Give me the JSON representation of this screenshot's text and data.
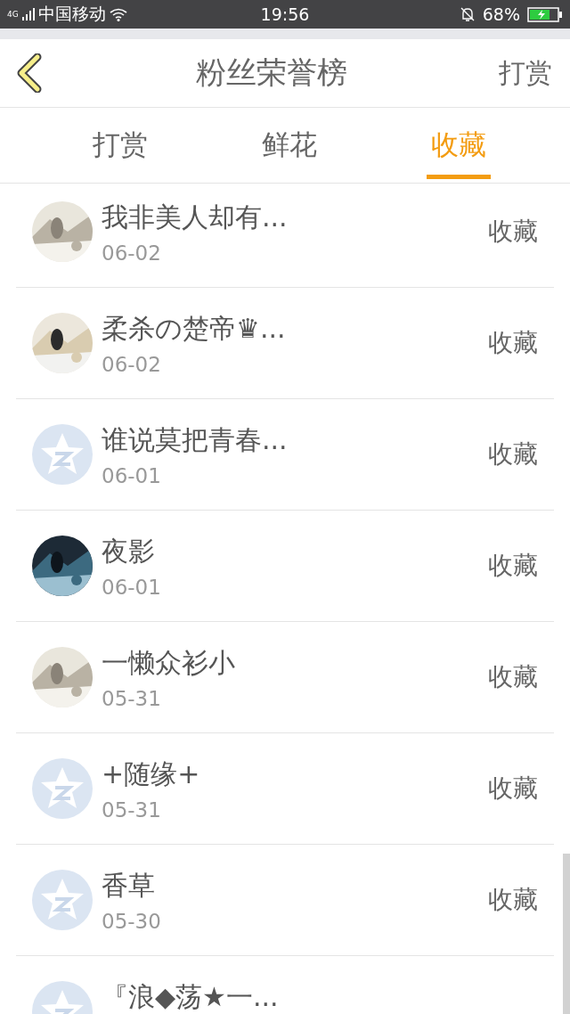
{
  "status_bar": {
    "network": "4G",
    "carrier": "中国移动",
    "time": "19:56",
    "battery": "68%"
  },
  "header": {
    "title": "粉丝荣誉榜",
    "action": "打赏"
  },
  "tabs": [
    {
      "label": "打赏",
      "selected": false
    },
    {
      "label": "鲜花",
      "selected": false
    },
    {
      "label": "收藏",
      "selected": true
    }
  ],
  "rows": [
    {
      "name": "我非美人却有...",
      "date": "06-02",
      "action": "收藏"
    },
    {
      "name": "柔杀の楚帝♛...",
      "date": "06-02",
      "action": "收藏"
    },
    {
      "kind": "default",
      "name": "谁说莫把青春...",
      "date": "06-01",
      "action": "收藏"
    },
    {
      "name": "夜影",
      "date": "06-01",
      "action": "收藏"
    },
    {
      "name": "一懒众衫小",
      "date": "05-31",
      "action": "收藏"
    },
    {
      "kind": "default",
      "name": "+随缘+",
      "date": "05-31",
      "action": "收藏"
    },
    {
      "kind": "default",
      "name": "香草",
      "date": "05-30",
      "action": "收藏"
    },
    {
      "kind": "default",
      "name": "『浪◆荡★一..."
    }
  ]
}
